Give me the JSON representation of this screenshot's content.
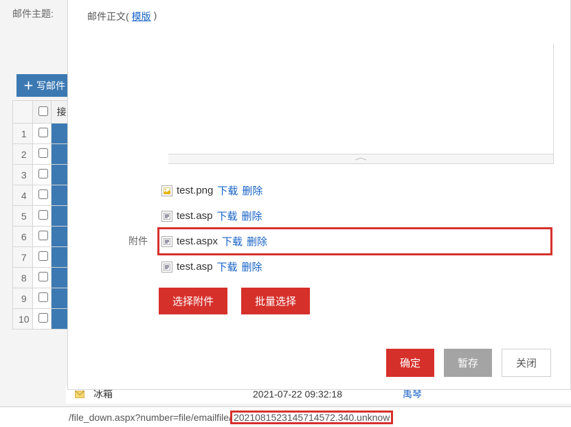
{
  "bg": {
    "subject_label": "邮件主题:",
    "compose": "写邮件",
    "corner": "接"
  },
  "rows": [
    "1",
    "2",
    "3",
    "4",
    "5",
    "6",
    "7",
    "8",
    "9",
    "10"
  ],
  "modal": {
    "body_label_prefix": "邮件正文(",
    "body_template_link": "模版",
    "body_label_suffix": ")",
    "attach_label": "附件",
    "attachments": [
      {
        "name": "test.png",
        "download": "下载",
        "del": "删除",
        "icon": "image",
        "hl": false
      },
      {
        "name": "test.asp",
        "download": "下载",
        "del": "删除",
        "icon": "script",
        "hl": false
      },
      {
        "name": "test.aspx",
        "download": "下载",
        "del": "删除",
        "icon": "script",
        "hl": true
      },
      {
        "name": "test.asp",
        "download": "下载",
        "del": "删除",
        "icon": "script",
        "hl": false
      }
    ],
    "select_attach": "选择附件",
    "batch_select": "批量选择",
    "confirm": "确定",
    "save_draft": "暂存",
    "close": "关闭"
  },
  "underlying": {
    "sender": "冰箱",
    "date": "2021-07-22 09:32:18",
    "name": "禹琴"
  },
  "status": {
    "url_prefix": "/file_down.aspx?number=file/emailfile/",
    "url_file": "2021081523145714572.340.unknow"
  }
}
